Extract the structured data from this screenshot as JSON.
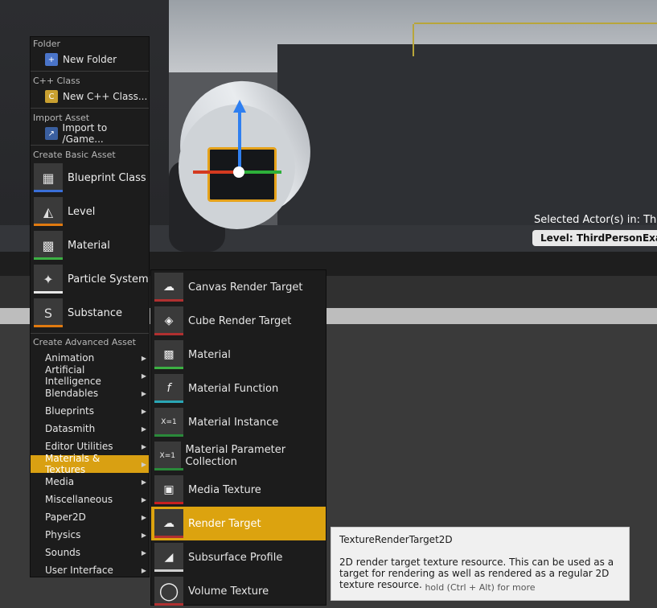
{
  "viewport": {
    "selected_label": "Selected Actor(s) in:  Third",
    "level_label": "Level:  ThirdPersonExample"
  },
  "menu": {
    "sections": {
      "folder": "Folder",
      "cpp": "C++ Class",
      "import": "Import Asset",
      "basic": "Create Basic Asset",
      "advanced": "Create Advanced Asset"
    },
    "small_items": {
      "new_folder": "New Folder",
      "new_cpp": "New C++ Class...",
      "import_to": "Import to /Game..."
    },
    "basic_items": [
      {
        "label": "Blueprint Class",
        "color": "#3a6fd8"
      },
      {
        "label": "Level",
        "color": "#e07a10"
      },
      {
        "label": "Material",
        "color": "#3cb043"
      },
      {
        "label": "Particle System",
        "color": "#e8e8e8"
      },
      {
        "label": "Substance",
        "color": "#e07a10"
      }
    ],
    "advanced_items": [
      "Animation",
      "Artificial Intelligence",
      "Blendables",
      "Blueprints",
      "Datasmith",
      "Editor Utilities",
      "Materials & Textures",
      "Media",
      "Miscellaneous",
      "Paper2D",
      "Physics",
      "Sounds",
      "User Interface"
    ],
    "active_item": "Materials & Textures"
  },
  "submenu": {
    "items": [
      {
        "label": "Canvas Render Target",
        "color": "#b03030"
      },
      {
        "label": "Cube Render Target",
        "color": "#b03030"
      },
      {
        "label": "Material",
        "color": "#3cb043"
      },
      {
        "label": "Material Function",
        "color": "#2aa6b5"
      },
      {
        "label": "Material Instance",
        "color": "#2a8a3a"
      },
      {
        "label": "Material Parameter Collection",
        "color": "#2a8a3a"
      },
      {
        "label": "Media Texture",
        "color": "#c82020"
      },
      {
        "label": "Render Target",
        "color": "#b03030"
      },
      {
        "label": "Subsurface Profile",
        "color": "#cfcfcf"
      },
      {
        "label": "Volume Texture",
        "color": "#b03030"
      }
    ],
    "active_item": "Render Target"
  },
  "tooltip": {
    "title": "TextureRenderTarget2D",
    "description": "2D render target texture resource. This can be used as a target for rendering as well as rendered as a regular 2D texture resource.",
    "hint": "hold (Ctrl + Alt) for more"
  },
  "colors": {
    "accent": "#dca30f",
    "menu_bg": "#1c1c1c"
  }
}
